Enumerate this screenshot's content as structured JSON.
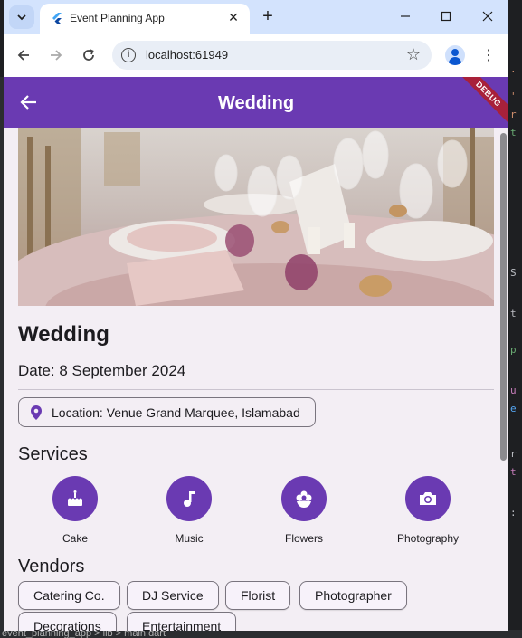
{
  "browser": {
    "tab_title": "Event Planning App",
    "url": "localhost:61949",
    "tab_close": "✕",
    "new_tab": "+",
    "minimize": "—",
    "maximize": "☐",
    "close": "✕"
  },
  "app": {
    "appbar_title": "Wedding",
    "debug_banner": "DEBUG",
    "accent_color": "#6a3ab2",
    "event": {
      "title": "Wedding",
      "date": "Date: 8 September 2024",
      "location": "Location: Venue Grand Marquee, Islamabad"
    },
    "services": {
      "heading": "Services",
      "items": [
        {
          "label": "Cake",
          "icon": "cake-icon"
        },
        {
          "label": "Music",
          "icon": "music-note-icon"
        },
        {
          "label": "Flowers",
          "icon": "flower-icon"
        },
        {
          "label": "Photography",
          "icon": "camera-icon"
        }
      ]
    },
    "vendors": {
      "heading": "Vendors",
      "items": [
        "Catering Co.",
        "DJ Service",
        "Florist",
        "Photographer",
        "Decorations",
        "Entertainment"
      ]
    }
  },
  "ide_bottom": "event_planning_app > lib > main.dart"
}
